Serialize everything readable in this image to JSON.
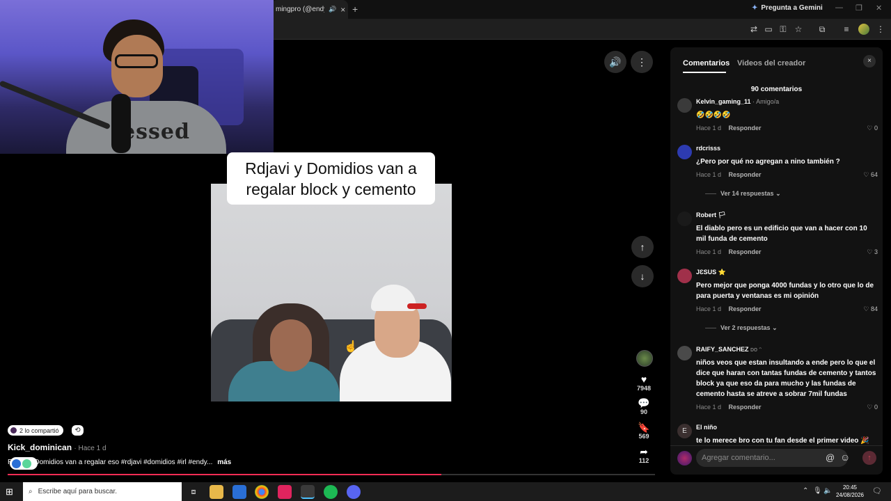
{
  "browser": {
    "tab_title": "mingpro (@endyga",
    "tab_close": "×",
    "new_tab": "+",
    "gemini_label": "Pregunta a Gemini",
    "gemini_icon": "sparkle-icon"
  },
  "video": {
    "caption": "Rdjavi y Domidios van a regalar block y cemento",
    "volume_icon": "🔊",
    "more_icon": "⋮",
    "nav_up": "↑",
    "nav_down": "↓",
    "actions": {
      "like_count": "7948",
      "comment_count": "90",
      "save_count": "569",
      "share_count": "112"
    },
    "shared_text": "2 lo compartió",
    "username": "Kick_dominican",
    "time": "· Hace 1 d",
    "description": "Rdjavi y Domidios van a regalar eso #rdjavi #domidios #irl #endy...",
    "more_label": "más",
    "progress": 0.67,
    "accent_color": "#fe2c55"
  },
  "panel": {
    "tab_comments": "Comentarios",
    "tab_creator_videos": "Videos del creador",
    "close": "×",
    "count_label": "90 comentarios",
    "comments": [
      {
        "user": "Kelvin_gaming_11",
        "tag": "· Amigo/a",
        "text": "🤣🤣🤣🤣",
        "time": "Hace 1 d",
        "reply": "Responder",
        "likes": "0"
      },
      {
        "user": "rdcrisss",
        "tag": "",
        "text": "¿Pero por qué no agregan a nino también ?",
        "time": "Hace 1 d",
        "reply": "Responder",
        "likes": "64",
        "replies": "Ver 14 respuestas"
      },
      {
        "user": "Robert 🏳",
        "tag": "",
        "text": "El diablo pero es un edificio que van a hacer con 10 mil funda de cemento",
        "time": "Hace 1 d",
        "reply": "Responder",
        "likes": "3"
      },
      {
        "user": "JƐSUS ⭐",
        "tag": "",
        "text": "Pero mejor que ponga 4000 fundas y lo otro que lo de para puerta y ventanas es mi opinión",
        "time": "Hace 1 d",
        "reply": "Responder",
        "likes": "84",
        "replies": "Ver 2 respuestas"
      },
      {
        "user": "RAIFY_SANCHEZ",
        "tag": "ᴅᴏ ᵔ",
        "text": "niños veos que estan insultando a ende pero lo que el dice que haran con tantas fundas de cemento y tantos block ya que eso da para mucho y las fundas de cemento hasta se atreve a sobrar 7mil fundas",
        "time": "Hace 1 d",
        "reply": "Responder",
        "likes": "0"
      },
      {
        "user": "El niño",
        "tag": "",
        "avatar_letter": "E",
        "text": "te lo merece bro con tu fan desde el primer video 🎉"
      }
    ],
    "input_placeholder": "Agregar comentario...",
    "at_icon": "@",
    "emoji_icon": "☺"
  },
  "taskbar": {
    "search_placeholder": "Escribe aquí para buscar.",
    "time": "20:45",
    "date": "24/08/2026"
  }
}
